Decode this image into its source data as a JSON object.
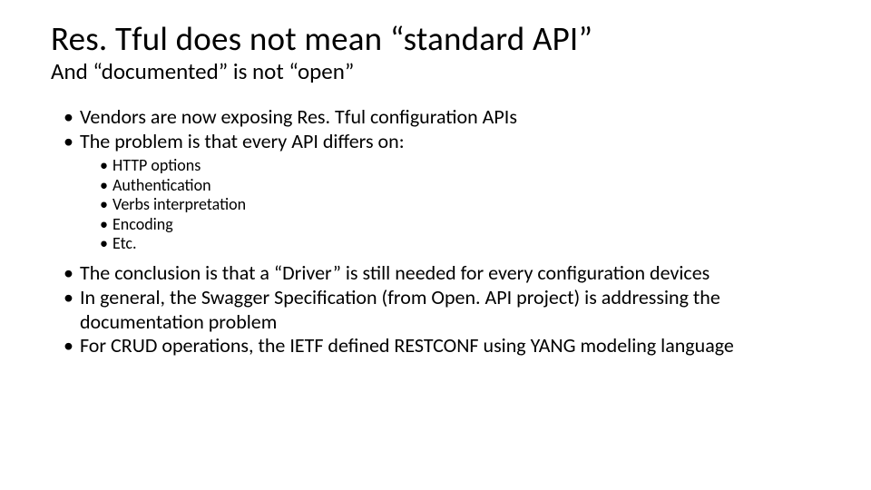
{
  "title": "Res. Tful does not mean “standard API”",
  "subtitle": "And “documented” is not “open”",
  "bullets_top": [
    "Vendors are now exposing Res. Tful configuration APIs",
    "The problem is that every API differs on:"
  ],
  "sub_bullets": [
    "HTTP options",
    "Authentication",
    "Verbs interpretation",
    "Encoding",
    "Etc."
  ],
  "bullets_bottom": [
    "The conclusion is that a “Driver” is still needed for every configuration devices",
    "In general, the Swagger Specification (from Open. API project) is addressing the documentation problem",
    "For CRUD operations, the IETF defined RESTCONF using YANG modeling language"
  ]
}
